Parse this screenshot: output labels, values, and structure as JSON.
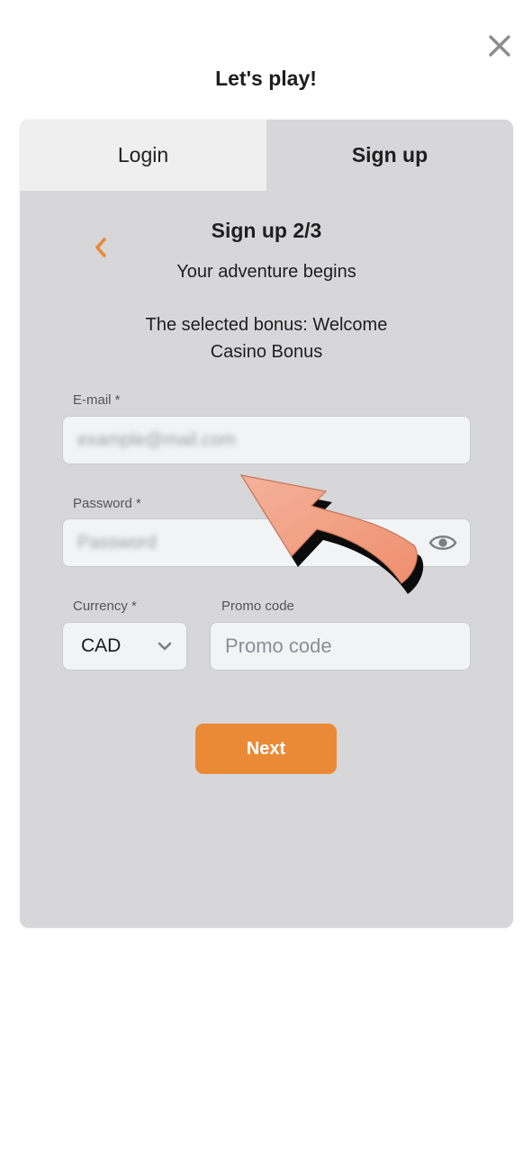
{
  "header": {
    "title": "Let's play!",
    "close_icon": "close-icon"
  },
  "tabs": [
    {
      "label": "Login",
      "active": false
    },
    {
      "label": "Sign up",
      "active": true
    }
  ],
  "form": {
    "step_title": "Sign up 2/3",
    "subtitle": "Your adventure begins",
    "bonus_text": "The selected bonus: Welcome Casino Bonus",
    "email": {
      "label": "E-mail *",
      "placeholder": "example@mail.com"
    },
    "password": {
      "label": "Password *",
      "placeholder": "Password"
    },
    "currency": {
      "label": "Currency *",
      "value": "CAD"
    },
    "promo": {
      "label": "Promo code",
      "placeholder": "Promo code"
    },
    "next_label": "Next"
  },
  "colors": {
    "accent": "#ea8a36",
    "card_background": "#d7d7d9",
    "inactive_tab": "#efefef",
    "arrow_overlay": "#f2a081"
  }
}
